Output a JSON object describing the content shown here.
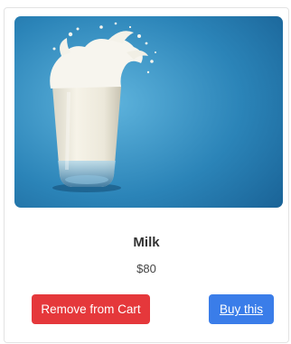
{
  "product": {
    "name": "Milk",
    "price": "$80",
    "image_subject": "glass of milk with splash"
  },
  "actions": {
    "remove_label": "Remove from Cart",
    "buy_label": "Buy this"
  },
  "colors": {
    "remove_button": "#e5383b",
    "buy_button": "#3a7de9",
    "image_background": "#2f86b8"
  }
}
